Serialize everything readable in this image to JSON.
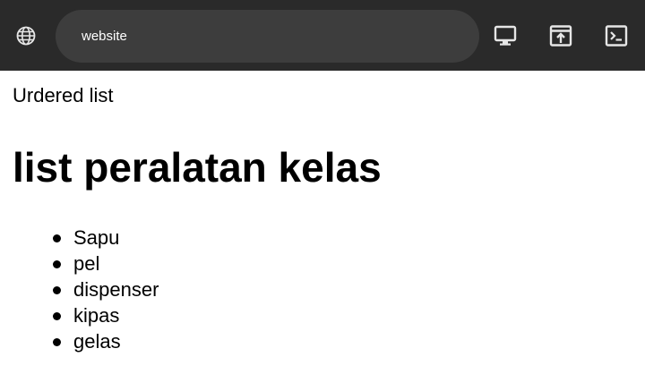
{
  "toolbar": {
    "url": "website",
    "icons": [
      "globe-icon",
      "desktop-icon",
      "open-in-new-icon",
      "terminal-icon"
    ]
  },
  "page": {
    "top_text": "Urdered list",
    "heading": "list peralatan kelas",
    "items": [
      "Sapu",
      "pel",
      "dispenser",
      "kipas",
      "gelas"
    ]
  },
  "colors": {
    "toolbar_bg": "#2a2a2a",
    "urlbar_bg": "#3d3d3d",
    "page_bg": "#ffffff",
    "text": "#000000"
  }
}
